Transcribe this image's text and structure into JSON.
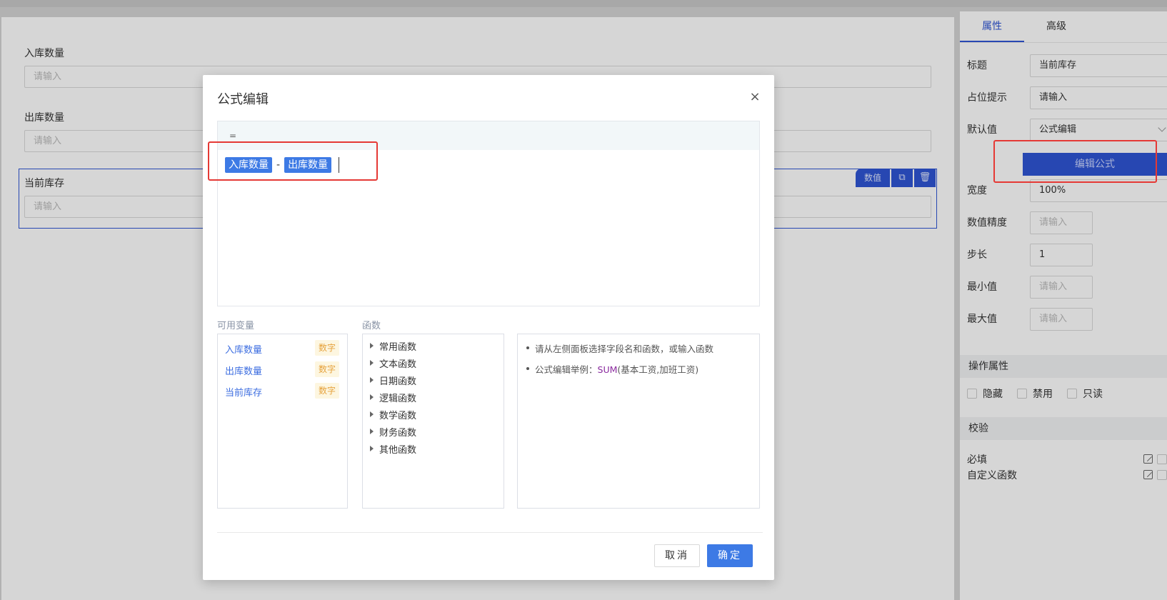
{
  "form": {
    "fields": [
      {
        "label": "入库数量",
        "placeholder": "请输入"
      },
      {
        "label": "出库数量",
        "placeholder": "请输入"
      },
      {
        "label": "当前库存",
        "placeholder": "请输入"
      }
    ],
    "selected_toolbar": {
      "type_label": "数值"
    }
  },
  "sidebar": {
    "tabs": [
      "属性",
      "高级"
    ],
    "props": {
      "title_label": "标题",
      "title_value": "当前库存",
      "placeholder_label": "占位提示",
      "placeholder_value": "请输入",
      "default_label": "默认值",
      "default_value": "公式编辑",
      "edit_formula_button": "编辑公式",
      "width_label": "宽度",
      "width_value": "100%",
      "precision_label": "数值精度",
      "precision_placeholder": "请输入",
      "step_label": "步长",
      "step_value": "1",
      "min_label": "最小值",
      "min_placeholder": "请输入",
      "max_label": "最大值",
      "max_placeholder": "请输入"
    },
    "sections": {
      "operation": "操作属性",
      "validation": "校验"
    },
    "operation_checks": [
      "隐藏",
      "禁用",
      "只读"
    ],
    "validation_rows": [
      "必填",
      "自定义函数"
    ]
  },
  "modal": {
    "title": "公式编辑",
    "equals_sign": "=",
    "formula": {
      "token1": "入库数量",
      "operator": "-",
      "token2": "出库数量"
    },
    "variables_label": "可用变量",
    "variables": [
      {
        "name": "入库数量",
        "type": "数字"
      },
      {
        "name": "出库数量",
        "type": "数字"
      },
      {
        "name": "当前库存",
        "type": "数字"
      }
    ],
    "functions_label": "函数",
    "functions": [
      "常用函数",
      "文本函数",
      "日期函数",
      "逻辑函数",
      "数学函数",
      "财务函数",
      "其他函数"
    ],
    "hints": {
      "hint1": "请从左侧面板选择字段名和函数，或输入函数",
      "hint2_prefix": "公式编辑举例：",
      "hint2_fn": "SUM",
      "hint2_args": "(基本工资,加班工资)"
    },
    "cancel_label": "取消",
    "ok_label": "确定"
  },
  "colors": {
    "primary": "#2f55d4",
    "token": "#3d7ae5",
    "highlight": "#e53935",
    "type_badge": "#e6a23c"
  }
}
